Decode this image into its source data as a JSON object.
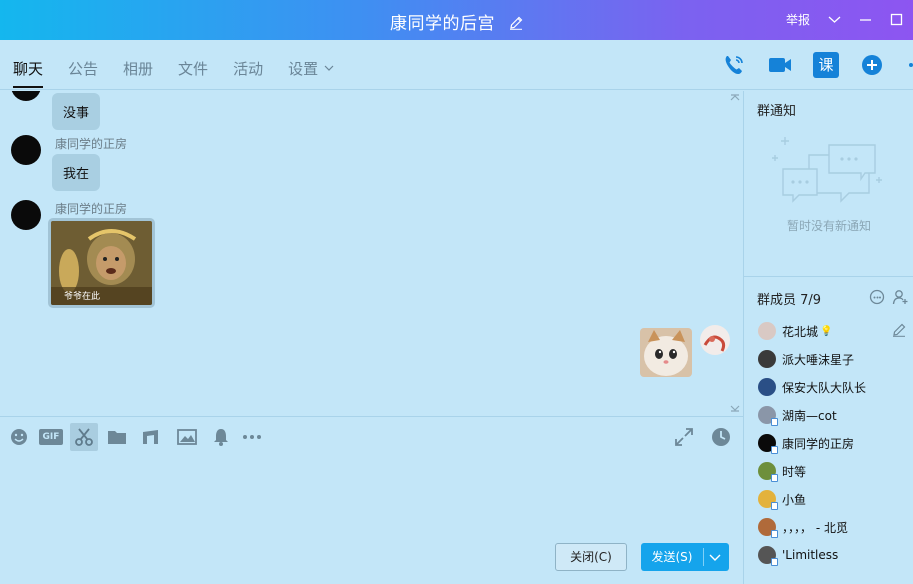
{
  "window": {
    "title": "康同学的后宫",
    "report_label": "举报"
  },
  "tabs": [
    {
      "label": "聊天",
      "active": true
    },
    {
      "label": "公告"
    },
    {
      "label": "相册"
    },
    {
      "label": "文件"
    },
    {
      "label": "活动"
    },
    {
      "label": "设置"
    }
  ],
  "header_tools": [
    "phone-icon",
    "video-icon",
    "class-icon",
    "add-app-icon"
  ],
  "class_tool_label": "课",
  "messages": [
    {
      "sender": "",
      "text": "没事",
      "type": "text"
    },
    {
      "sender": "康同学的正房",
      "text": "我在",
      "type": "text"
    },
    {
      "sender": "康同学的正房",
      "type": "image",
      "image_caption": "爷爷在此"
    },
    {
      "sender": "self",
      "type": "image"
    }
  ],
  "toolbar_icons": [
    "emoji-icon",
    "gif-icon",
    "screenshot-icon",
    "folder-icon",
    "music-icon",
    "image-icon",
    "bell-icon",
    "more-icon"
  ],
  "gif_label": "GIF",
  "buttons": {
    "close": "关闭(C)",
    "send": "发送(S)"
  },
  "sidebar": {
    "notice_title": "群通知",
    "notice_empty": "暂时没有新通知",
    "members_title": "群成员 7/9",
    "members": [
      {
        "name": "花北城",
        "color": "#d9c9c4",
        "badge": "💡"
      },
      {
        "name": "派大唾沫星子",
        "color": "#3a3a3a"
      },
      {
        "name": "保安大队大队长",
        "color": "#2a4f86"
      },
      {
        "name": "湖南—cot",
        "color": "#8a96a8"
      },
      {
        "name": "康同学的正房",
        "color": "#0a0a0a"
      },
      {
        "name": "时等",
        "color": "#6e8f3c"
      },
      {
        "name": "小鱼",
        "color": "#e3b23c"
      },
      {
        "name": "，，，，  - 北觅",
        "color": "#b06a3a"
      },
      {
        "name": "'Limitless",
        "color": "#555555"
      }
    ]
  },
  "colors": {
    "accent": "#15a4ec",
    "chat_bg": "#c3e6f8",
    "title_gradient_start": "#14b7ee",
    "title_gradient_end": "#8d55f1"
  }
}
